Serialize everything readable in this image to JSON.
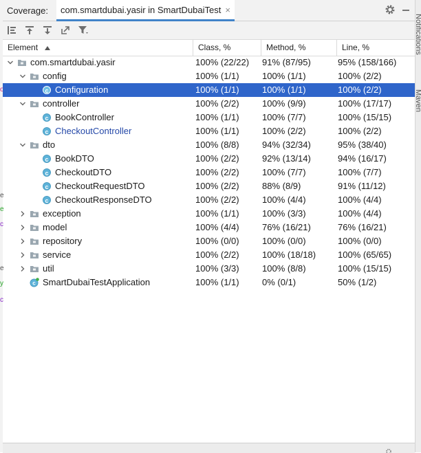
{
  "header": {
    "title": "Coverage:",
    "tab_label": "com.smartdubai.yasir in SmartDubaiTest",
    "tab_close": "×"
  },
  "toolbar": {
    "buttons": [
      "flatten-packages-icon",
      "go-to-parent-icon",
      "go-to-child-icon",
      "export-icon",
      "filter-icon"
    ]
  },
  "columns": {
    "element": "Element",
    "class": "Class, %",
    "method": "Method, %",
    "line": "Line, %"
  },
  "right_stripe": {
    "notifications": "Notifications",
    "maven": "Maven"
  },
  "rows": [
    {
      "label": "com.smartdubai.yasir",
      "type": "package",
      "indent": 0,
      "expanded": true,
      "class": "100% (22/22)",
      "method": "91% (87/95)",
      "line": "95% (158/166)"
    },
    {
      "label": "config",
      "type": "package",
      "indent": 1,
      "expanded": true,
      "class": "100% (1/1)",
      "method": "100% (1/1)",
      "line": "100% (2/2)"
    },
    {
      "label": "Configuration",
      "type": "class",
      "indent": 2,
      "selected": true,
      "class": "100% (1/1)",
      "method": "100% (1/1)",
      "line": "100% (2/2)"
    },
    {
      "label": "controller",
      "type": "package",
      "indent": 1,
      "expanded": true,
      "class": "100% (2/2)",
      "method": "100% (9/9)",
      "line": "100% (17/17)"
    },
    {
      "label": "BookController",
      "type": "class",
      "indent": 2,
      "class": "100% (1/1)",
      "method": "100% (7/7)",
      "line": "100% (15/15)"
    },
    {
      "label": "CheckoutController",
      "type": "class",
      "indent": 2,
      "link": true,
      "class": "100% (1/1)",
      "method": "100% (2/2)",
      "line": "100% (2/2)"
    },
    {
      "label": "dto",
      "type": "package",
      "indent": 1,
      "expanded": true,
      "class": "100% (8/8)",
      "method": "94% (32/34)",
      "line": "95% (38/40)"
    },
    {
      "label": "BookDTO",
      "type": "class",
      "indent": 2,
      "class": "100% (2/2)",
      "method": "92% (13/14)",
      "line": "94% (16/17)"
    },
    {
      "label": "CheckoutDTO",
      "type": "class",
      "indent": 2,
      "class": "100% (2/2)",
      "method": "100% (7/7)",
      "line": "100% (7/7)"
    },
    {
      "label": "CheckoutRequestDTO",
      "type": "class",
      "indent": 2,
      "class": "100% (2/2)",
      "method": "88% (8/9)",
      "line": "91% (11/12)"
    },
    {
      "label": "CheckoutResponseDTO",
      "type": "class",
      "indent": 2,
      "class": "100% (2/2)",
      "method": "100% (4/4)",
      "line": "100% (4/4)"
    },
    {
      "label": "exception",
      "type": "package",
      "indent": 1,
      "expanded": false,
      "class": "100% (1/1)",
      "method": "100% (3/3)",
      "line": "100% (4/4)"
    },
    {
      "label": "model",
      "type": "package",
      "indent": 1,
      "expanded": false,
      "class": "100% (4/4)",
      "method": "76% (16/21)",
      "line": "76% (16/21)"
    },
    {
      "label": "repository",
      "type": "package",
      "indent": 1,
      "expanded": false,
      "class": "100% (0/0)",
      "method": "100% (0/0)",
      "line": "100% (0/0)"
    },
    {
      "label": "service",
      "type": "package",
      "indent": 1,
      "expanded": false,
      "class": "100% (2/2)",
      "method": "100% (18/18)",
      "line": "100% (65/65)"
    },
    {
      "label": "util",
      "type": "package",
      "indent": 1,
      "expanded": false,
      "class": "100% (3/3)",
      "method": "100% (8/8)",
      "line": "100% (15/15)"
    },
    {
      "label": "SmartDubaiTestApplication",
      "type": "app",
      "indent": 1,
      "class": "100% (1/1)",
      "method": "0% (0/1)",
      "line": "50% (1/2)"
    }
  ],
  "colors": {
    "selection": "#2f65ca",
    "tab_underline": "#4083c9",
    "class_icon": "#5eb3d9",
    "link_text": "#2448a8"
  }
}
